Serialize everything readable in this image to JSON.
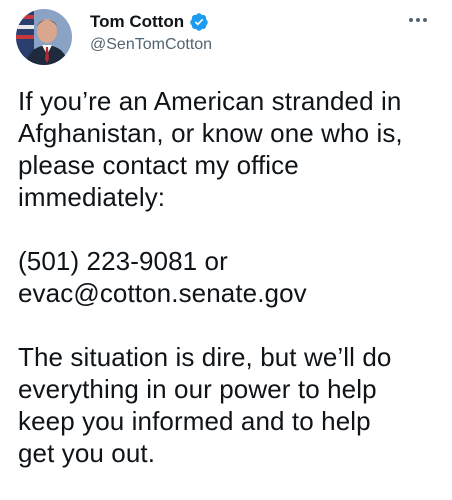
{
  "author": {
    "display_name": "Tom Cotton",
    "handle": "@SenTomCotton",
    "verified": true,
    "avatar_icon": "profile-photo",
    "verified_icon": "verified-badge-icon"
  },
  "menu": {
    "more_icon": "more-options-icon"
  },
  "tweet": {
    "paragraph_1": [
      "If you’re an American stranded in",
      "Afghanistan, or know one who is,",
      "please contact my office",
      "immediately:"
    ],
    "paragraph_2": [
      "(501) 223-9081 or",
      "evac@cotton.senate.gov"
    ],
    "paragraph_3": [
      "The situation is dire, but we’ll do",
      "everything in our power to help",
      "keep you informed and to help",
      "get you out."
    ]
  },
  "colors": {
    "verified_blue": "#1d9bf0",
    "secondary_text": "#536471",
    "primary_text": "#0f1419"
  }
}
